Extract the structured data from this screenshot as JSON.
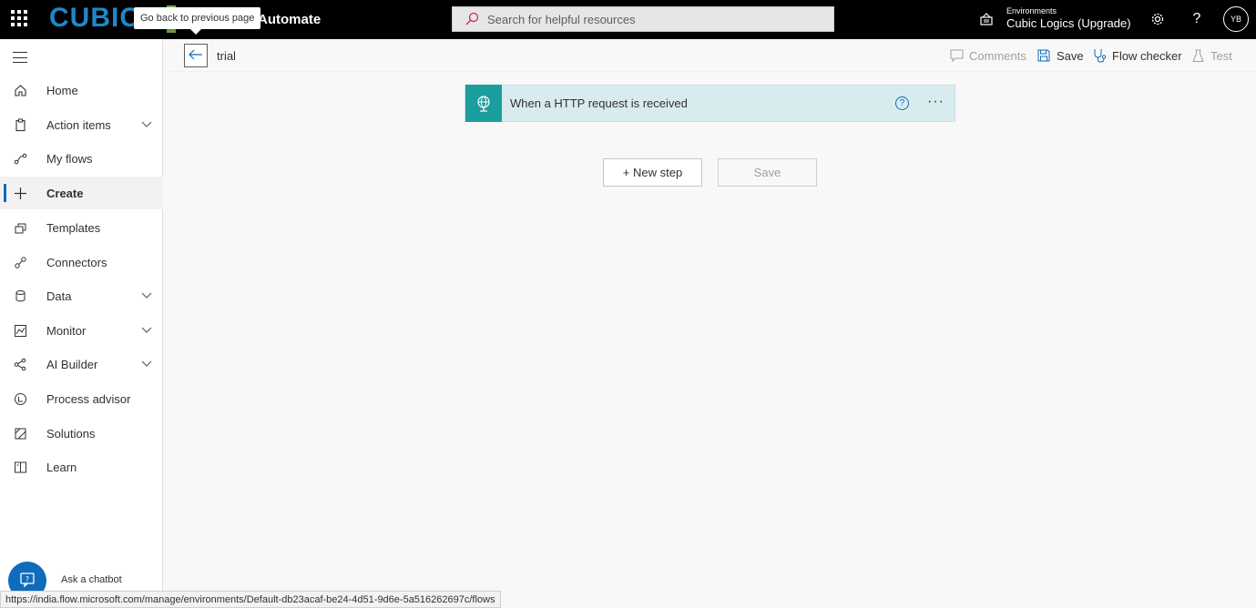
{
  "topbar": {
    "logo_text": "CUBIC",
    "app_name": "Automate",
    "tooltip": "Go back to previous page",
    "search_placeholder": "Search for helpful resources",
    "environment_label": "Environments",
    "environment_name": "Cubic Logics (Upgrade)",
    "avatar_initials": "YB"
  },
  "sidebar": {
    "items": [
      {
        "label": "Home",
        "icon": "home-icon"
      },
      {
        "label": "Action items",
        "icon": "clipboard-icon",
        "expandable": true
      },
      {
        "label": "My flows",
        "icon": "flow-icon"
      },
      {
        "label": "Create",
        "icon": "plus-icon",
        "active": true
      },
      {
        "label": "Templates",
        "icon": "templates-icon"
      },
      {
        "label": "Connectors",
        "icon": "connectors-icon"
      },
      {
        "label": "Data",
        "icon": "database-icon",
        "expandable": true
      },
      {
        "label": "Monitor",
        "icon": "monitor-icon",
        "expandable": true
      },
      {
        "label": "AI Builder",
        "icon": "ai-builder-icon",
        "expandable": true
      },
      {
        "label": "Process advisor",
        "icon": "process-advisor-icon"
      },
      {
        "label": "Solutions",
        "icon": "solutions-icon"
      },
      {
        "label": "Learn",
        "icon": "book-icon"
      }
    ],
    "chatbot_label": "Ask a chatbot"
  },
  "commandbar": {
    "flow_name": "trial",
    "comments": "Comments",
    "save": "Save",
    "flow_checker": "Flow checker",
    "test": "Test"
  },
  "canvas": {
    "trigger_title": "When a HTTP request is received",
    "help_glyph": "?",
    "more_glyph": "···",
    "new_step": "+ New step",
    "save": "Save"
  },
  "statusbar": {
    "url": "https://india.flow.microsoft.com/manage/environments/Default-db23acaf-be24-4d51-9d6e-5a516262697c/flows"
  },
  "colors": {
    "accent": "#0f6cbd",
    "trigger_icon_bg": "#1b9e9e",
    "trigger_bg": "#d8ecef",
    "topbar_bg": "#000000"
  }
}
